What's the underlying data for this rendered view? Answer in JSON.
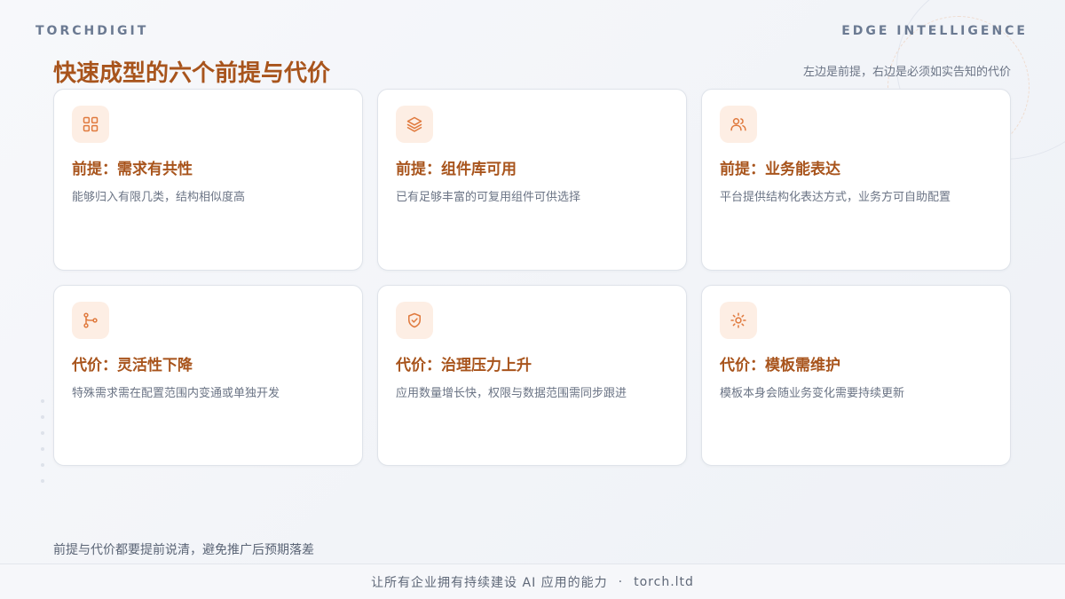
{
  "header": {
    "brand_left": "TORCHDIGIT",
    "brand_right": "EDGE INTELLIGENCE",
    "title": "快速成型的六个前提与代价",
    "subtitle": "左边是前提，右边是必须如实告知的代价"
  },
  "accent_color": "#a8541c",
  "icon_color": "#e07a3e",
  "cards": [
    {
      "icon": "grid-icon",
      "title": "前提：需求有共性",
      "desc": "能够归入有限几类，结构相似度高"
    },
    {
      "icon": "layers-icon",
      "title": "前提：组件库可用",
      "desc": "已有足够丰富的可复用组件可供选择"
    },
    {
      "icon": "users-icon",
      "title": "前提：业务能表达",
      "desc": "平台提供结构化表达方式，业务方可自助配置"
    },
    {
      "icon": "branch-icon",
      "title": "代价：灵活性下降",
      "desc": "特殊需求需在配置范围内变通或单独开发"
    },
    {
      "icon": "shield-check-icon",
      "title": "代价：治理压力上升",
      "desc": "应用数量增长快，权限与数据范围需同步跟进"
    },
    {
      "icon": "sun-icon",
      "title": "代价：模板需维护",
      "desc": "模板本身会随业务变化需要持续更新"
    }
  ],
  "note": "前提与代价都要提前说清，避免推广后预期落差",
  "footer": {
    "slogan": "让所有企业拥有持续建设 AI 应用的能力",
    "separator": "·",
    "site": "torch.ltd"
  }
}
